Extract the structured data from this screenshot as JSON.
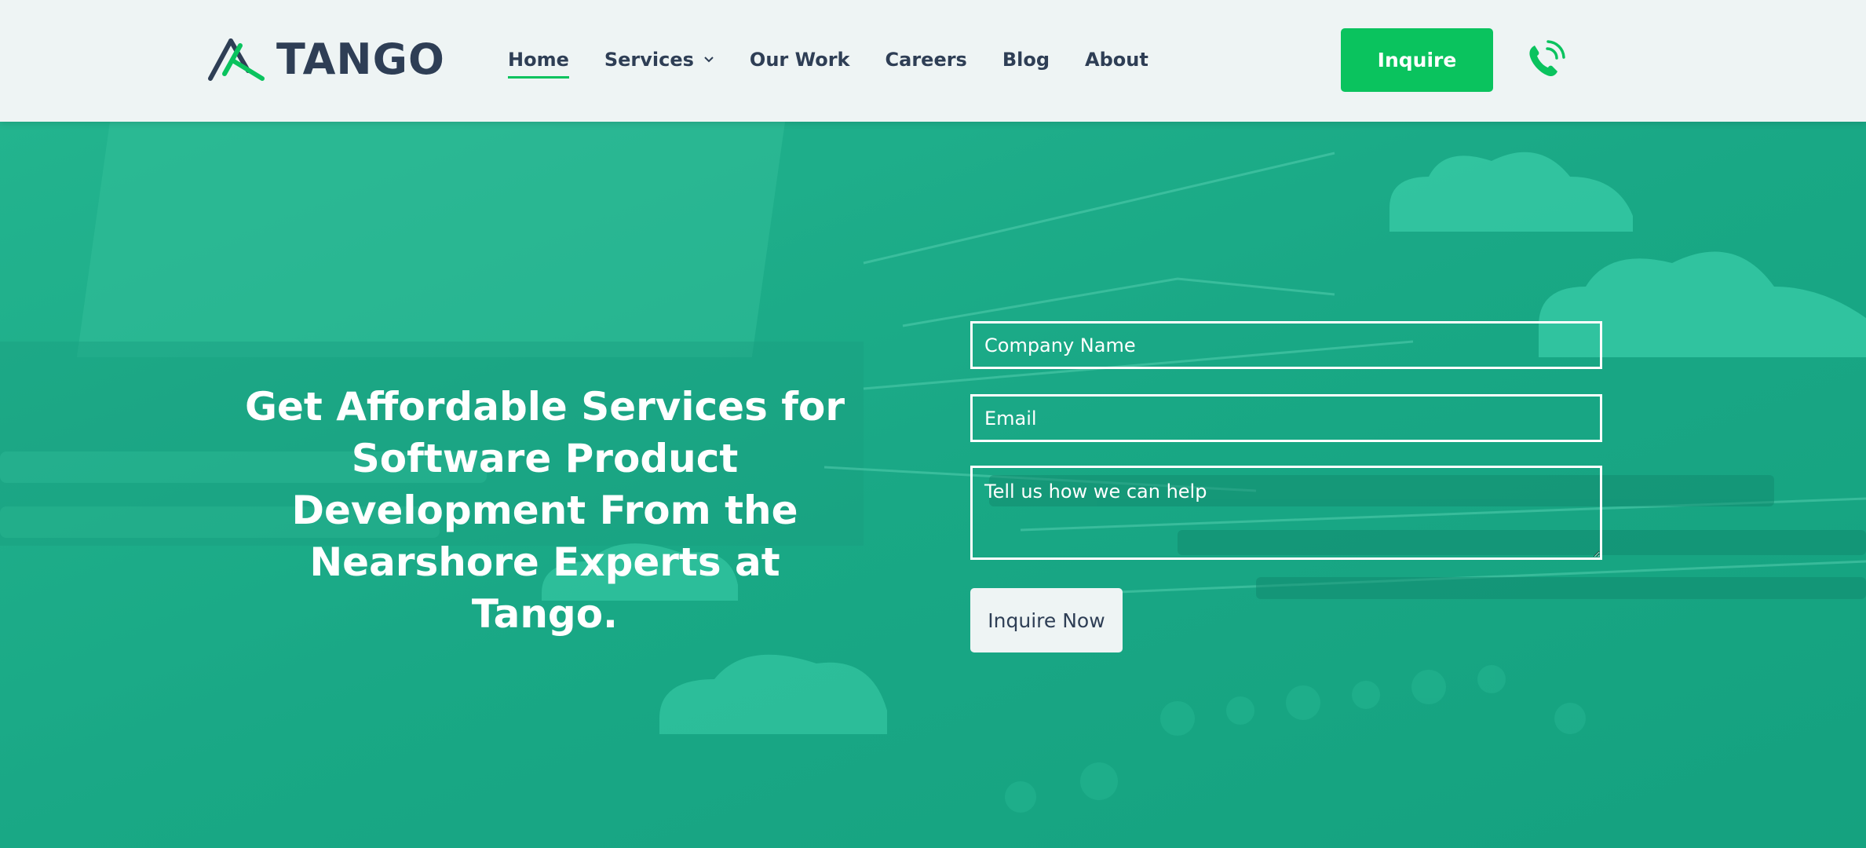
{
  "brand": {
    "name": "TANGO",
    "accent": "#0ac35e",
    "dark": "#2e3e55"
  },
  "nav": {
    "items": [
      {
        "label": "Home",
        "active": true
      },
      {
        "label": "Services",
        "dropdown": true
      },
      {
        "label": "Our Work"
      },
      {
        "label": "Careers"
      },
      {
        "label": "Blog"
      },
      {
        "label": "About"
      }
    ],
    "inquire_label": "Inquire",
    "phone_icon": "phone-icon"
  },
  "hero": {
    "title": "Get Affordable Services for Software Product Development From the Nearshore Experts at Tango.",
    "form": {
      "company_placeholder": "Company Name",
      "email_placeholder": "Email",
      "message_placeholder": "Tell us how we can help",
      "submit_label": "Inquire Now"
    }
  }
}
